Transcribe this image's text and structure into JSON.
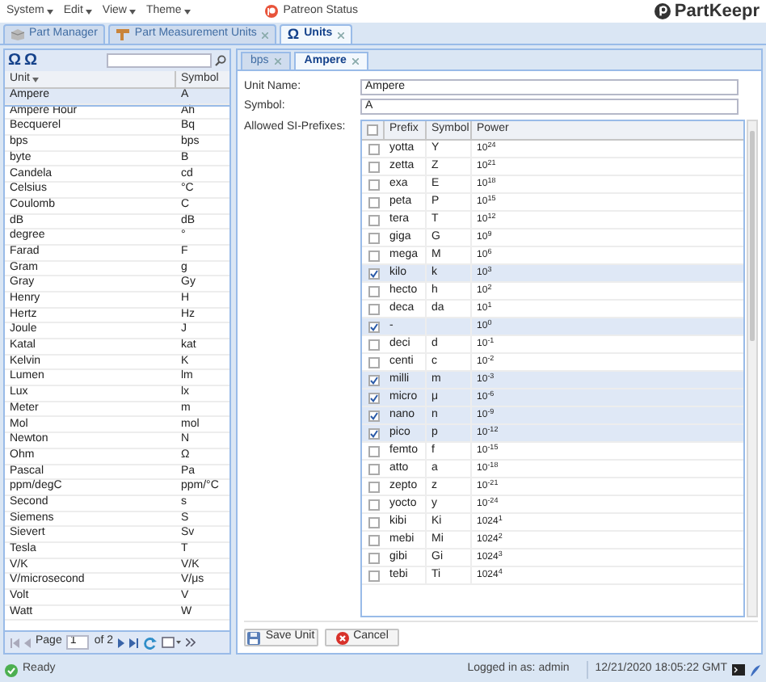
{
  "menu": [
    {
      "label": "System"
    },
    {
      "label": "Edit"
    },
    {
      "label": "View"
    },
    {
      "label": "Theme"
    }
  ],
  "patreon": "Patreon Status",
  "logo": "PartKeepr",
  "main_tabs": [
    {
      "label": "Part Manager",
      "selected": false,
      "closable": false
    },
    {
      "label": "Part Measurement Units",
      "selected": false,
      "closable": true
    },
    {
      "label": "Units",
      "icon": "Ω",
      "selected": true,
      "closable": true
    }
  ],
  "toolbar_icons": [
    "Ω",
    "Ω"
  ],
  "units": {
    "columns": [
      "Unit",
      "Symbol"
    ],
    "rows": [
      {
        "unit": "Ampere",
        "symbol": "A",
        "selected": true
      },
      {
        "unit": "Ampere Hour",
        "symbol": "Ah",
        "selected": false
      },
      {
        "unit": "Becquerel",
        "symbol": "Bq",
        "selected": false
      },
      {
        "unit": "bps",
        "symbol": "bps",
        "selected": false
      },
      {
        "unit": "byte",
        "symbol": "B",
        "selected": false
      },
      {
        "unit": "Candela",
        "symbol": "cd",
        "selected": false
      },
      {
        "unit": "Celsius",
        "symbol": "°C",
        "selected": false
      },
      {
        "unit": "Coulomb",
        "symbol": "C",
        "selected": false
      },
      {
        "unit": "dB",
        "symbol": "dB",
        "selected": false
      },
      {
        "unit": "degree",
        "symbol": "°",
        "selected": false
      },
      {
        "unit": "Farad",
        "symbol": "F",
        "selected": false
      },
      {
        "unit": "Gram",
        "symbol": "g",
        "selected": false
      },
      {
        "unit": "Gray",
        "symbol": "Gy",
        "selected": false
      },
      {
        "unit": "Henry",
        "symbol": "H",
        "selected": false
      },
      {
        "unit": "Hertz",
        "symbol": "Hz",
        "selected": false
      },
      {
        "unit": "Joule",
        "symbol": "J",
        "selected": false
      },
      {
        "unit": "Katal",
        "symbol": "kat",
        "selected": false
      },
      {
        "unit": "Kelvin",
        "symbol": "K",
        "selected": false
      },
      {
        "unit": "Lumen",
        "symbol": "lm",
        "selected": false
      },
      {
        "unit": "Lux",
        "symbol": "lx",
        "selected": false
      },
      {
        "unit": "Meter",
        "symbol": "m",
        "selected": false
      },
      {
        "unit": "Mol",
        "symbol": "mol",
        "selected": false
      },
      {
        "unit": "Newton",
        "symbol": "N",
        "selected": false
      },
      {
        "unit": "Ohm",
        "symbol": "Ω",
        "selected": false
      },
      {
        "unit": "Pascal",
        "symbol": "Pa",
        "selected": false
      },
      {
        "unit": "ppm/degC",
        "symbol": "ppm/°C",
        "selected": false
      },
      {
        "unit": "Second",
        "symbol": "s",
        "selected": false
      },
      {
        "unit": "Siemens",
        "symbol": "S",
        "selected": false
      },
      {
        "unit": "Sievert",
        "symbol": "Sv",
        "selected": false
      },
      {
        "unit": "Tesla",
        "symbol": "T",
        "selected": false
      },
      {
        "unit": "V/K",
        "symbol": "V/K",
        "selected": false
      },
      {
        "unit": "V/microsecond",
        "symbol": "V/μs",
        "selected": false
      },
      {
        "unit": "Volt",
        "symbol": "V",
        "selected": false
      },
      {
        "unit": "Watt",
        "symbol": "W",
        "selected": false
      }
    ]
  },
  "pager": {
    "page_label": "Page",
    "page": "1",
    "of": "of 2"
  },
  "editor_tabs": [
    {
      "label": "bps",
      "selected": false
    },
    {
      "label": "Ampere",
      "selected": true
    }
  ],
  "form": {
    "fields": [
      {
        "label": "Unit Name:",
        "value": "Ampere"
      },
      {
        "label": "Symbol:",
        "value": "A"
      }
    ],
    "prefixes_label": "Allowed SI-Prefixes:",
    "prefix_columns": [
      "Prefix",
      "Symbol",
      "Power"
    ],
    "all_checked": false,
    "prefixes": [
      {
        "prefix": "yotta",
        "symbol": "Y",
        "power": "10$^{24}$",
        "checked": false
      },
      {
        "prefix": "zetta",
        "symbol": "Z",
        "power": "10$^{21}$",
        "checked": false
      },
      {
        "prefix": "exa",
        "symbol": "E",
        "power": "10$^{18}$",
        "checked": false
      },
      {
        "prefix": "peta",
        "symbol": "P",
        "power": "10$^{15}$",
        "checked": false
      },
      {
        "prefix": "tera",
        "symbol": "T",
        "power": "10$^{12}$",
        "checked": false
      },
      {
        "prefix": "giga",
        "symbol": "G",
        "power": "10$^{9}$",
        "checked": false
      },
      {
        "prefix": "mega",
        "symbol": "M",
        "power": "10$^{6}$",
        "checked": false
      },
      {
        "prefix": "kilo",
        "symbol": "k",
        "power": "10$^{3}$",
        "checked": true
      },
      {
        "prefix": "hecto",
        "symbol": "h",
        "power": "10$^{2}$",
        "checked": false
      },
      {
        "prefix": "deca",
        "symbol": "da",
        "power": "10$^{1}$",
        "checked": false
      },
      {
        "prefix": "-",
        "power": "10$^{0}$",
        "checked": true
      },
      {
        "prefix": "deci",
        "symbol": "d",
        "power": "10$^{-1}$",
        "checked": false
      },
      {
        "prefix": "centi",
        "symbol": "c",
        "power": "10$^{-2}$",
        "checked": false
      },
      {
        "prefix": "milli",
        "symbol": "m",
        "power": "10$^{-3}$",
        "checked": true
      },
      {
        "prefix": "micro",
        "symbol": "μ",
        "power": "10$^{-6}$",
        "checked": true
      },
      {
        "prefix": "nano",
        "symbol": "n",
        "power": "10$^{-9}$",
        "checked": true
      },
      {
        "prefix": "pico",
        "symbol": "p",
        "power": "10$^{-12}$",
        "checked": true
      },
      {
        "prefix": "femto",
        "symbol": "f",
        "power": "10$^{-15}$",
        "checked": false
      },
      {
        "prefix": "atto",
        "symbol": "a",
        "power": "10$^{-18}$",
        "checked": false
      },
      {
        "prefix": "zepto",
        "symbol": "z",
        "power": "10$^{-21}$",
        "checked": false
      },
      {
        "prefix": "yocto",
        "symbol": "y",
        "power": "10$^{-24}$",
        "checked": false
      },
      {
        "prefix": "kibi",
        "symbol": "Ki",
        "power": "1024$^{1}$",
        "checked": false
      },
      {
        "prefix": "mebi",
        "symbol": "Mi",
        "power": "1024$^{2}$",
        "checked": false
      },
      {
        "prefix": "gibi",
        "symbol": "Gi",
        "power": "1024$^{3}$",
        "checked": false
      },
      {
        "prefix": "tebi",
        "symbol": "Ti",
        "power": "1024$^{4}$",
        "checked": false
      }
    ]
  },
  "buttons": [
    {
      "label": "Save Unit",
      "kind": "save"
    },
    {
      "label": "Cancel",
      "kind": "cancel"
    }
  ],
  "status": "Ready",
  "footer": {
    "login": "Logged in as: admin",
    "datetime": "12/21/2020 18:05:22 GMT"
  }
}
